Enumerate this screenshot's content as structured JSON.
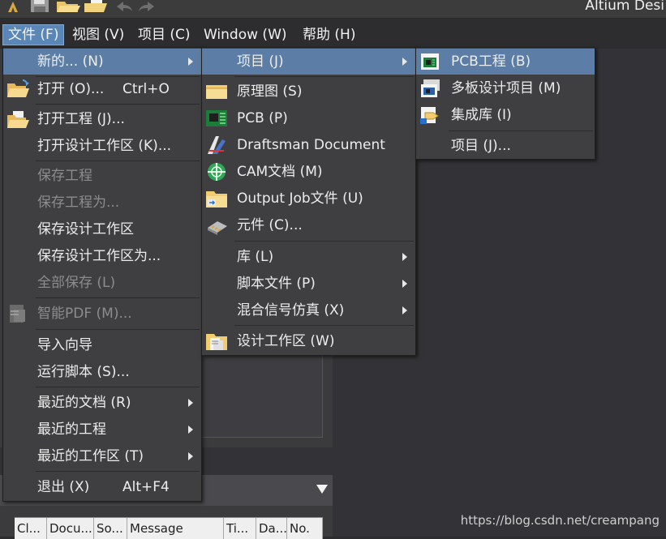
{
  "app": {
    "title": "Altium Desi"
  },
  "toolbar": {
    "icons": [
      "app-logo-icon",
      "save-icon",
      "open-folder-icon",
      "open-project-icon",
      "undo-icon",
      "redo-icon"
    ]
  },
  "menubar": {
    "items": [
      "文件 (F)",
      "视图 (V)",
      "项目 (C)",
      "Window (W)",
      "帮助 (H)"
    ]
  },
  "file_menu": {
    "items": [
      {
        "label": "新的... (N)",
        "submenu": true,
        "highlighted": true
      },
      {
        "label": "打开 (O)...",
        "shortcut": "Ctrl+O",
        "icon": "open-folder-icon"
      },
      {
        "label": "打开工程 (J)...",
        "icon": "open-project-icon"
      },
      {
        "label": "打开设计工作区 (K)..."
      },
      {
        "label": "保存工程",
        "disabled": true
      },
      {
        "label": "保存工程为...",
        "disabled": true
      },
      {
        "label": "保存设计工作区"
      },
      {
        "label": "保存设计工作区为..."
      },
      {
        "label": "全部保存 (L)",
        "disabled": true
      },
      {
        "label": "智能PDF (M)...",
        "disabled": true,
        "icon": "smart-pdf-icon"
      },
      {
        "label": "导入向导"
      },
      {
        "label": "运行脚本 (S)..."
      },
      {
        "label": "最近的文档 (R)",
        "submenu": true
      },
      {
        "label": "最近的工程",
        "submenu": true
      },
      {
        "label": "最近的工作区 (T)",
        "submenu": true
      },
      {
        "label": "退出 (X)",
        "shortcut": "Alt+F4"
      }
    ]
  },
  "new_menu": {
    "items": [
      {
        "label": "项目 (J)",
        "submenu": true,
        "highlighted": true
      },
      {
        "label": "原理图 (S)",
        "icon": "schematic-icon"
      },
      {
        "label": "PCB (P)",
        "icon": "pcb-icon"
      },
      {
        "label": "Draftsman Document",
        "icon": "draftsman-icon"
      },
      {
        "label": "CAM文档 (M)",
        "icon": "cam-icon"
      },
      {
        "label": "Output Job文件 (U)",
        "icon": "output-job-icon"
      },
      {
        "label": "元件 (C)...",
        "icon": "component-icon"
      },
      {
        "label": "库 (L)",
        "submenu": true
      },
      {
        "label": "脚本文件 (P)",
        "submenu": true
      },
      {
        "label": "混合信号仿真 (X)",
        "submenu": true
      },
      {
        "label": "设计工作区 (W)",
        "icon": "design-workspace-icon"
      }
    ]
  },
  "project_menu": {
    "items": [
      {
        "label": "PCB工程 (B)",
        "icon": "pcb-project-icon",
        "highlighted": true
      },
      {
        "label": "多板设计项目 (M)",
        "icon": "multiboard-project-icon"
      },
      {
        "label": "集成库 (I)",
        "icon": "integrated-library-icon"
      },
      {
        "label": "项目 (J)..."
      }
    ]
  },
  "messages_panel": {
    "columns": [
      "Cl...",
      "Docu...",
      "So...",
      "Message",
      "Ti...",
      "Da...",
      "No."
    ]
  },
  "watermark": "https://blog.csdn.net/creampang",
  "colors": {
    "menubar_active": "#5b86b8",
    "menu_highlight": "#5c7ea6",
    "menu_bg": "#3f3f42",
    "disabled_text": "#8c8c8c"
  }
}
